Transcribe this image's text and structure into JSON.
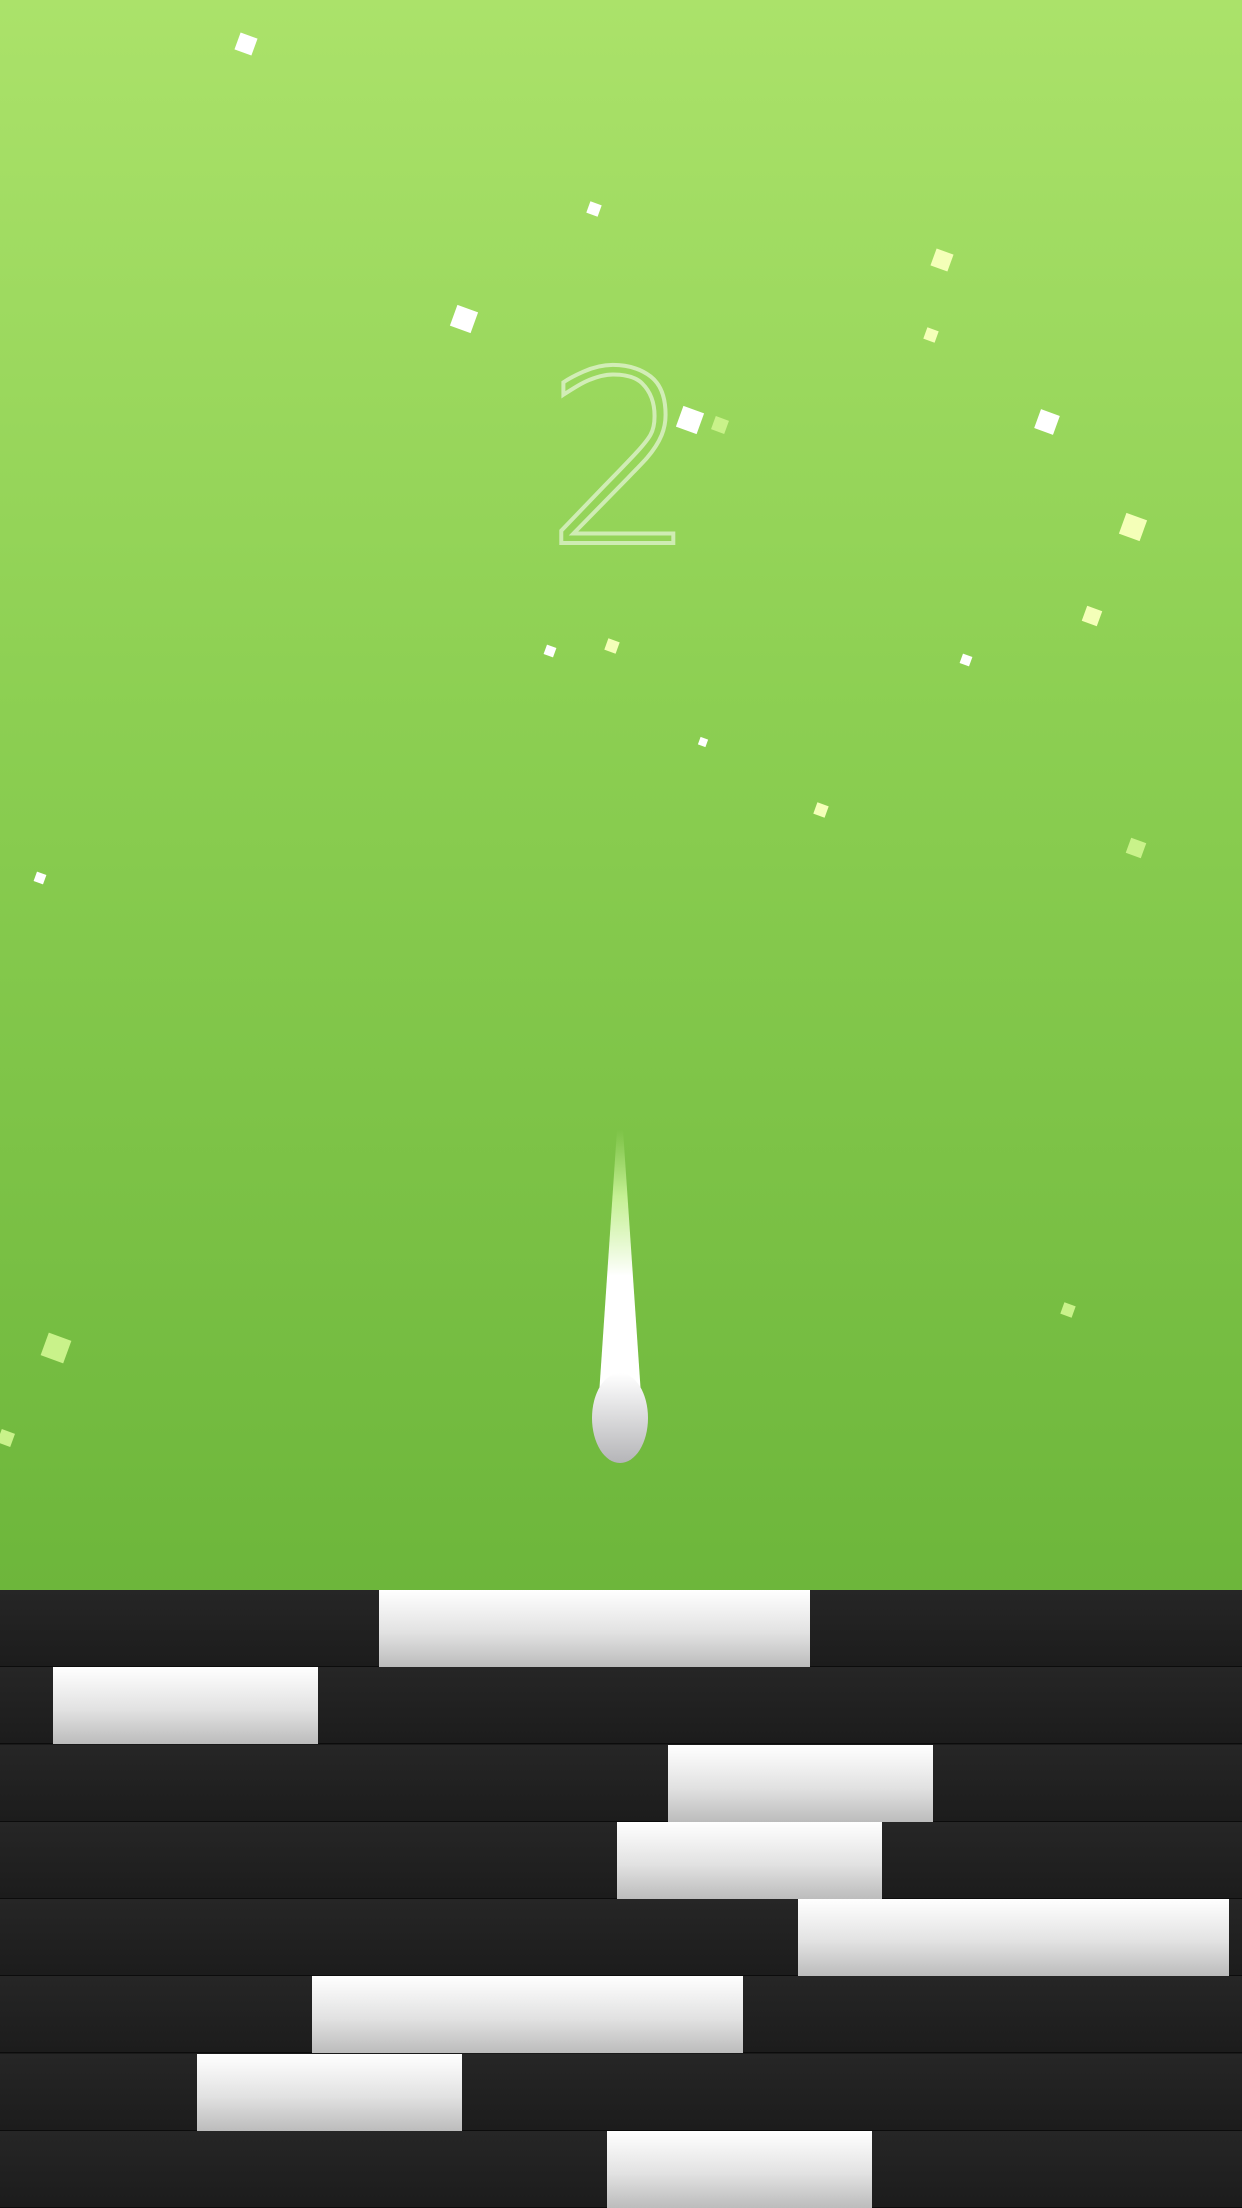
{
  "game": {
    "score": "2"
  },
  "colors": {
    "background_top": "#abe26a",
    "background_bottom": "#6db63b",
    "tile_dark": "#1c1c1c",
    "tile_light": "#ffffff",
    "particle_white": "#ffffff",
    "particle_yellow": "#f4ffb8",
    "particle_green": "#c9f28a"
  },
  "ball": {
    "icon": "ball-with-trail"
  }
}
